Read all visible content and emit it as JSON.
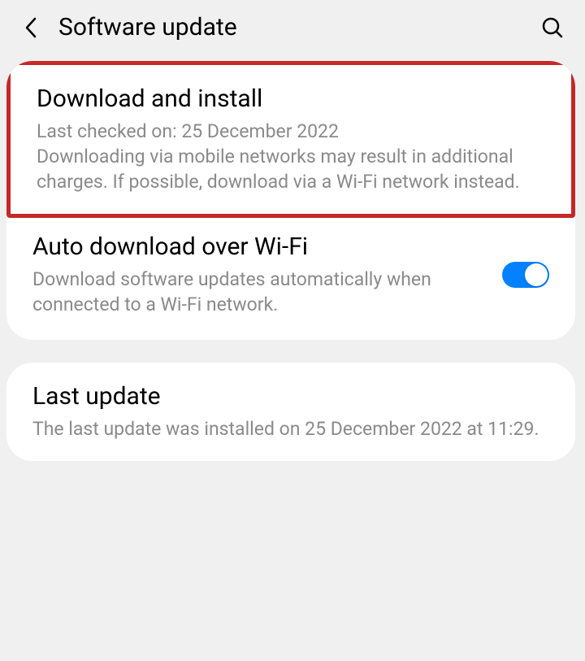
{
  "header": {
    "title": "Software update"
  },
  "sections": {
    "download_install": {
      "title": "Download and install",
      "subtitle": "Last checked on: 25 December 2022\nDownloading via mobile networks may result in additional charges. If possible, download via a Wi-Fi network instead."
    },
    "auto_download": {
      "title": "Auto download over Wi-Fi",
      "subtitle": "Download software updates automatically when connected to a Wi-Fi network.",
      "toggle_on": true
    },
    "last_update": {
      "title": "Last update",
      "subtitle": "The last update was installed on 25 December 2022 at 11:29."
    }
  }
}
